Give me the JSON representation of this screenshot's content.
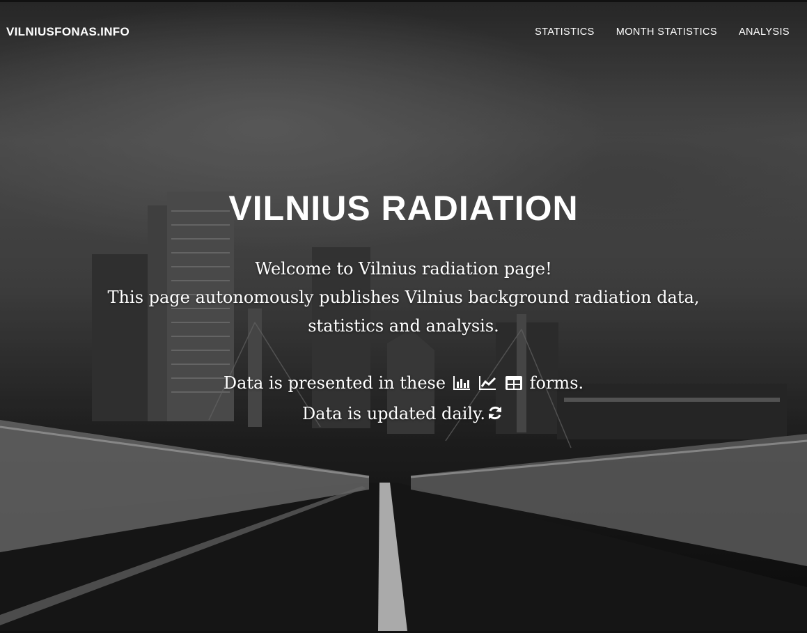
{
  "nav": {
    "brand": "VILNIUSFONAS.INFO",
    "links": [
      {
        "label": "STATISTICS"
      },
      {
        "label": "MONTH STATISTICS"
      },
      {
        "label": "ANALYSIS"
      }
    ]
  },
  "hero": {
    "title": "VILNIUS RADIATION",
    "line1": "Welcome to Vilnius radiation page!",
    "line2": "This page autonomously publishes Vilnius background radiation data,",
    "line3": "statistics and analysis.",
    "line4_before": "Data is presented in these",
    "line4_after": "forms.",
    "line5": "Data is updated daily.",
    "icons": [
      "bar-chart-icon",
      "line-chart-icon",
      "table-icon",
      "refresh-icon"
    ]
  }
}
